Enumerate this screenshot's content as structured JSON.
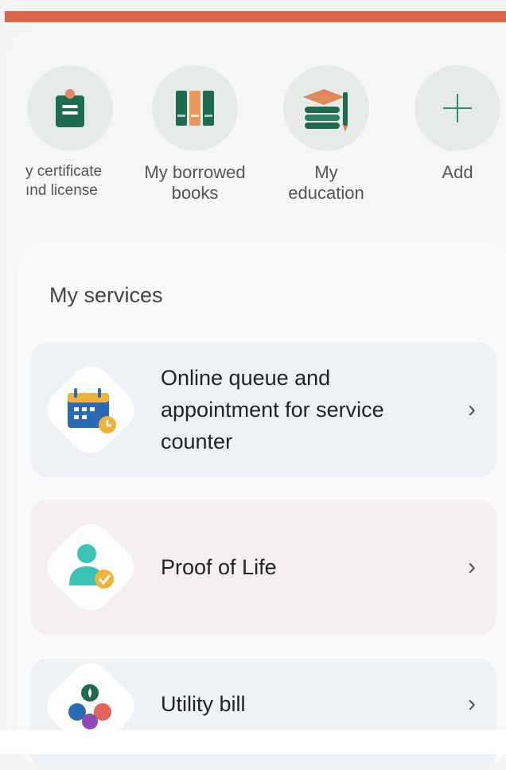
{
  "shortcuts": [
    {
      "label_line1": "y certificate",
      "label_line2": "ınd license"
    },
    {
      "label_line1": "My borrowed",
      "label_line2": "books"
    },
    {
      "label_line1": "My",
      "label_line2": "education"
    },
    {
      "label_line1": "Add",
      "label_line2": ""
    }
  ],
  "services": {
    "title": "My services",
    "items": [
      {
        "label": "Online queue and appointment for service counter",
        "chevron": "›"
      },
      {
        "label": "Proof of Life",
        "chevron": "›"
      },
      {
        "label": "Utility bill",
        "chevron": "›"
      }
    ]
  },
  "colors": {
    "accent_top": "#d9654a",
    "teal": "#3f9c8c",
    "green_dark": "#1f6b50",
    "orange": "#e8a048"
  },
  "icons": [
    "certificate-icon",
    "books-icon",
    "education-icon",
    "add-icon",
    "calendar-icon",
    "person-check-icon",
    "utility-icon",
    "chevron-right-icon"
  ]
}
